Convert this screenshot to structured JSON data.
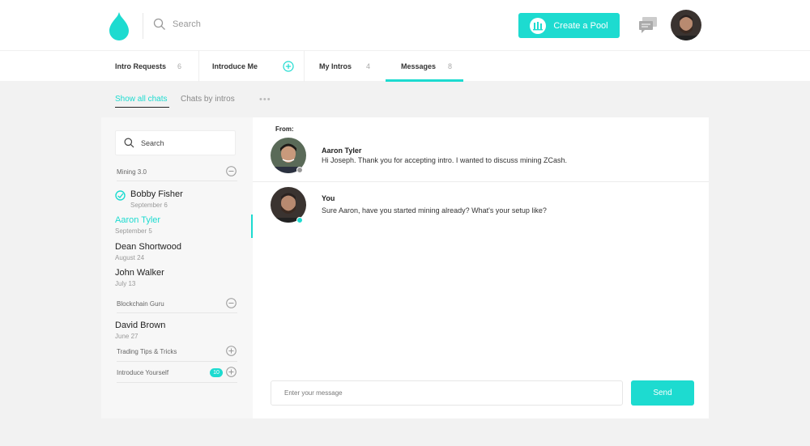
{
  "header": {
    "search_placeholder": "Search",
    "create_pool_label": "Create a Pool",
    "colors": {
      "accent": "#1ddbd0"
    },
    "icons": {
      "logo": "water-drop-icon",
      "search": "search-icon",
      "pool": "pool-icon",
      "messages": "chat-bubbles-icon"
    }
  },
  "tabs": [
    {
      "label": "Intro Requests",
      "count": "6"
    },
    {
      "label": "Introduce Me",
      "count": ""
    },
    {
      "label": "My Intros",
      "count": "4"
    },
    {
      "label": "Messages",
      "count": "8"
    }
  ],
  "subtabs": {
    "show_all": "Show all chats",
    "by_intros": "Chats by intros",
    "more": "•••"
  },
  "sidebar": {
    "search_placeholder": "Search",
    "groups": [
      {
        "name": "Mining 3.0",
        "state": "expanded"
      },
      {
        "name": "Blockchain Guru",
        "state": "expanded"
      },
      {
        "name": "Trading Tips & Tricks",
        "state": "collapsed"
      },
      {
        "name": "Introduce Yourself",
        "state": "collapsed",
        "badge": "10"
      }
    ],
    "contacts": [
      {
        "name": "Bobby Fisher",
        "date": "September 6"
      },
      {
        "name": "Aaron Tyler",
        "date": "September 5"
      },
      {
        "name": "Dean Shortwood",
        "date": "August 24"
      },
      {
        "name": "John Walker",
        "date": "July 13"
      },
      {
        "name": "David Brown",
        "date": "June 27"
      }
    ]
  },
  "chat": {
    "from_label": "From:",
    "messages": [
      {
        "sender": "Aaron Tyler",
        "text": "Hi Joseph. Thank you for accepting intro. I wanted to discuss mining ZCash.",
        "status": "offline"
      },
      {
        "sender": "You",
        "text": "Sure Aaron, have you started mining already? What's your setup like?",
        "status": "online"
      }
    ],
    "input_placeholder": "Enter your message",
    "send_label": "Send"
  }
}
